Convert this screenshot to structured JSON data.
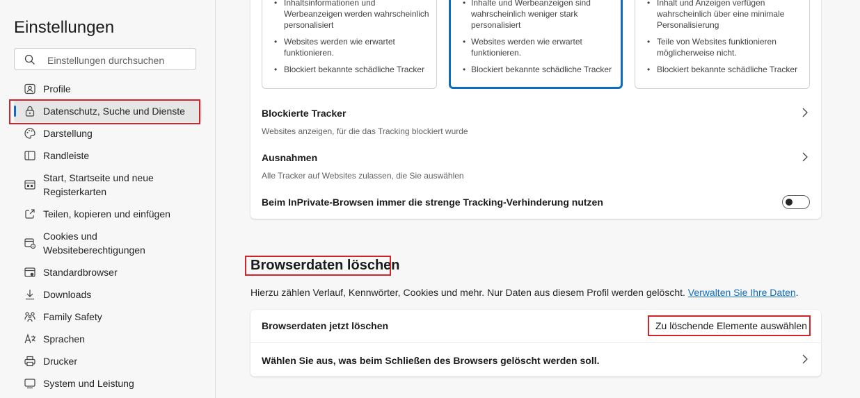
{
  "sidebar": {
    "title": "Einstellungen",
    "search_placeholder": "Einstellungen durchsuchen",
    "items": [
      {
        "label": "Profile",
        "icon": "profile-icon"
      },
      {
        "label": "Datenschutz, Suche und Dienste",
        "icon": "lock-icon",
        "active": true
      },
      {
        "label": "Darstellung",
        "icon": "palette-icon"
      },
      {
        "label": "Randleiste",
        "icon": "sidebar-icon"
      },
      {
        "label": "Start, Startseite und neue Registerkarten",
        "icon": "home-icon"
      },
      {
        "label": "Teilen, kopieren und einfügen",
        "icon": "share-icon"
      },
      {
        "label": "Cookies und Websiteberechtigungen",
        "icon": "cookies-icon"
      },
      {
        "label": "Standardbrowser",
        "icon": "browser-icon"
      },
      {
        "label": "Downloads",
        "icon": "download-icon"
      },
      {
        "label": "Family Safety",
        "icon": "family-icon"
      },
      {
        "label": "Sprachen",
        "icon": "language-icon"
      },
      {
        "label": "Drucker",
        "icon": "printer-icon"
      },
      {
        "label": "System und Leistung",
        "icon": "system-icon"
      }
    ]
  },
  "tracking": {
    "options": [
      {
        "bullets": [
          "Inhaltsinformationen und Werbeanzeigen werden wahrscheinlich personalisiert",
          "Websites werden wie erwartet funktionieren.",
          "Blockiert bekannte schädliche Tracker"
        ],
        "selected": false
      },
      {
        "bullets": [
          "Inhalte und Werbeanzeigen sind wahrscheinlich weniger stark personalisiert",
          "Websites werden wie erwartet funktionieren.",
          "Blockiert bekannte schädliche Tracker"
        ],
        "selected": true
      },
      {
        "bullets": [
          "Inhalt und Anzeigen verfügen wahrscheinlich über eine minimale Personalisierung",
          "Teile von Websites funktionieren möglicherweise nicht.",
          "Blockiert bekannte schädliche Tracker"
        ],
        "selected": false
      }
    ],
    "blocked_title": "Blockierte Tracker",
    "blocked_sub": "Websites anzeigen, für die das Tracking blockiert wurde",
    "exceptions_title": "Ausnahmen",
    "exceptions_sub": "Alle Tracker auf Websites zulassen, die Sie auswählen",
    "inprivate_label": "Beim InPrivate-Browsen immer die strenge Tracking-Verhinderung nutzen",
    "inprivate_on": false
  },
  "clear_data": {
    "title": "Browserdaten löschen",
    "description": "Hierzu zählen Verlauf, Kennwörter, Cookies und mehr. Nur Daten aus diesem Profil werden gelöscht.",
    "manage_link": "Verwalten Sie Ihre Daten",
    "description_end": ".",
    "now_label": "Browserdaten jetzt löschen",
    "choose_button": "Zu löschende Elemente auswählen",
    "on_close_label": "Wählen Sie aus, was beim Schließen des Browsers gelöscht werden soll."
  },
  "colors": {
    "accent": "#0f6cbd",
    "highlight": "#d2232a"
  }
}
